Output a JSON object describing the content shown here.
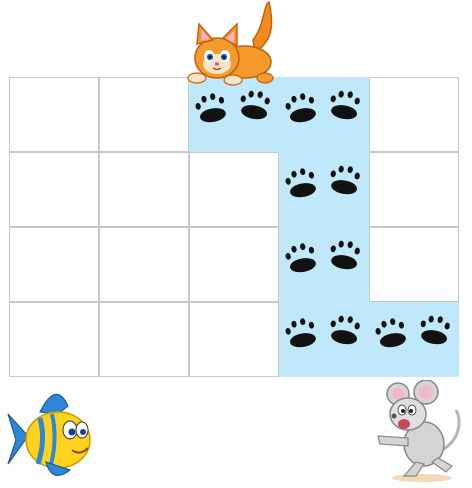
{
  "board": {
    "rows": 4,
    "cols": 5,
    "colors": {
      "path": "#bfe9fb",
      "grid_line": "#c9c9c9",
      "paw": "#111111"
    },
    "path_cells": [
      [
        0,
        2
      ],
      [
        0,
        3
      ],
      [
        1,
        3
      ],
      [
        2,
        3
      ],
      [
        3,
        3
      ],
      [
        3,
        4
      ]
    ]
  },
  "characters": {
    "cat": "orange-cat-icon",
    "fish": "yellow-fish-icon",
    "mouse": "grey-mouse-icon"
  }
}
